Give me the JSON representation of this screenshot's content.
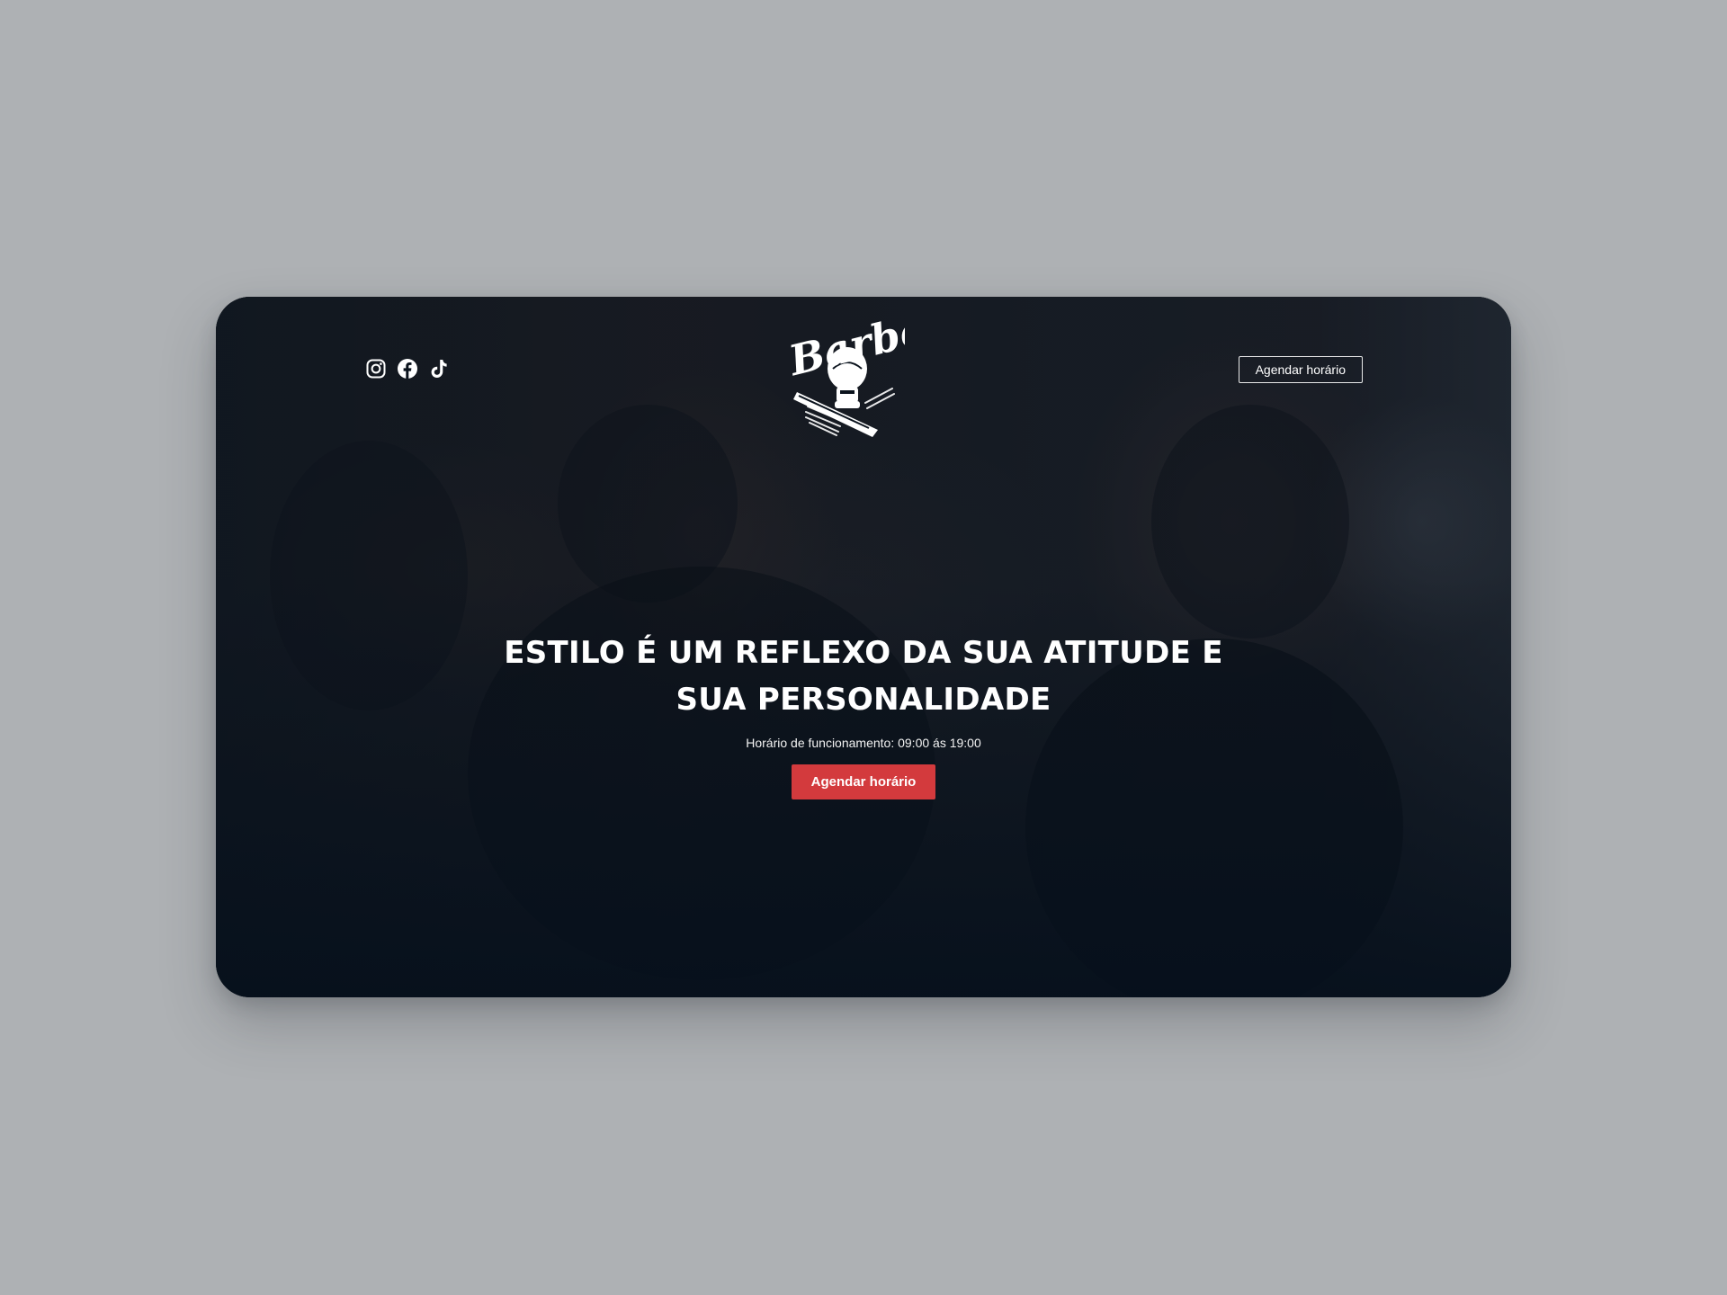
{
  "header": {
    "social": [
      {
        "icon": "instagram-icon"
      },
      {
        "icon": "facebook-icon"
      },
      {
        "icon": "tiktok-icon"
      }
    ],
    "logo_text": "Barber",
    "cta_label": "Agendar horário"
  },
  "hero": {
    "headline_line1": "ESTILO É UM REFLEXO DA SUA ATITUDE E",
    "headline_line2": "SUA PERSONALIDADE",
    "hours": "Horário de funcionamento: 09:00 ás 19:00",
    "cta_label": "Agendar horário"
  },
  "colors": {
    "page_background": "#aeb1b4",
    "card_overlay": "#08111c",
    "accent": "#d33a3d",
    "text": "#ffffff"
  }
}
